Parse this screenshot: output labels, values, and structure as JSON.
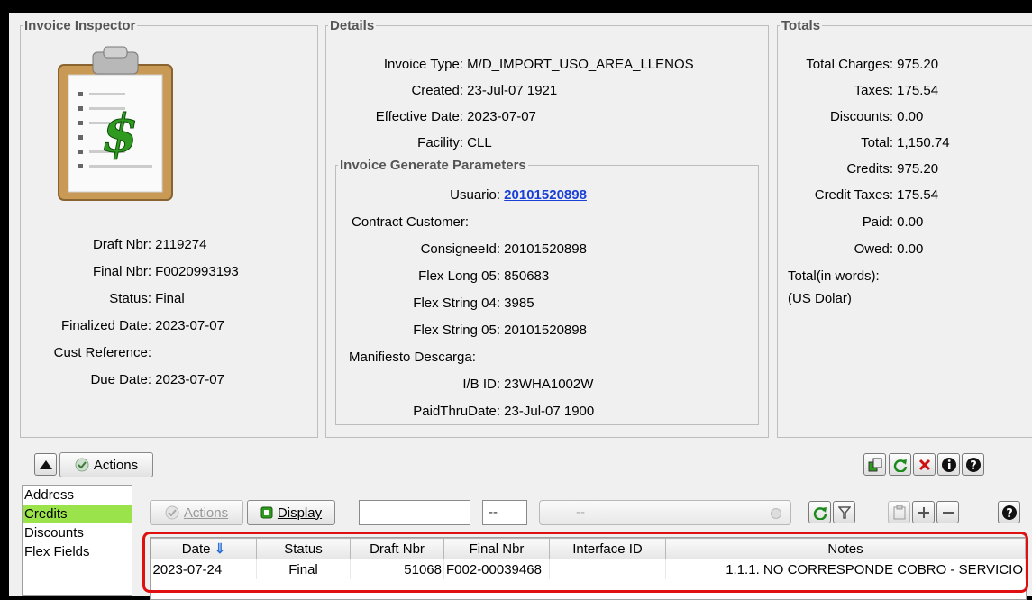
{
  "inspector": {
    "title": "Invoice Inspector",
    "fields": [
      {
        "label": "Draft Nbr:",
        "value": "2119274"
      },
      {
        "label": "Final Nbr:",
        "value": "F0020993193"
      },
      {
        "label": "Status:",
        "value": "Final"
      },
      {
        "label": "Finalized Date:",
        "value": "2023-07-07"
      },
      {
        "label": "Cust Reference:",
        "value": ""
      },
      {
        "label": "Due Date:",
        "value": "2023-07-07"
      }
    ]
  },
  "details": {
    "title": "Details",
    "fields": [
      {
        "label": "Invoice Type:",
        "value": "M/D_IMPORT_USO_AREA_LLENOS"
      },
      {
        "label": "Created:",
        "value": "23-Jul-07 1921"
      },
      {
        "label": "Effective Date:",
        "value": "2023-07-07"
      },
      {
        "label": "Facility:",
        "value": "CLL"
      }
    ],
    "params": {
      "title": "Invoice Generate Parameters",
      "usuario_label": "Usuario:",
      "usuario_value": "20101520898",
      "contract_customer": "Contract Customer:",
      "consignee_label": "ConsigneeId:",
      "consignee_value": "20101520898",
      "flex_long05_label": "Flex Long 05:",
      "flex_long05_value": "850683",
      "flex_string04_label": "Flex String 04:",
      "flex_string04_value": "3985",
      "flex_string05_label": "Flex String 05:",
      "flex_string05_value": "20101520898",
      "manifiesto": "Manifiesto Descarga:",
      "ib_label": "I/B ID:",
      "ib_value": "23WHA1002W",
      "paidthru_label": "PaidThruDate:",
      "paidthru_value": "23-Jul-07 1900"
    }
  },
  "totals": {
    "title": "Totals",
    "fields": [
      {
        "label": "Total Charges:",
        "value": "975.20"
      },
      {
        "label": "Taxes:",
        "value": "175.54"
      },
      {
        "label": "Discounts:",
        "value": "0.00"
      },
      {
        "label": "Total:",
        "value": "1,150.74"
      },
      {
        "label": "Credits:",
        "value": "975.20"
      },
      {
        "label": "Credit Taxes:",
        "value": "175.54"
      },
      {
        "label": "Paid:",
        "value": "0.00"
      },
      {
        "label": "Owed:",
        "value": "0.00"
      }
    ],
    "words_label": "Total(in words):",
    "words_value": "(US Dolar)"
  },
  "toolbar": {
    "actions_label": "Actions"
  },
  "sidebar": {
    "items": [
      "Address",
      "Credits",
      "Discounts",
      "Flex Fields"
    ],
    "selected": 1
  },
  "lower": {
    "actions_label": "Actions",
    "display_label": "Display",
    "filter_value": "",
    "combo1": "--",
    "combo2": "--"
  },
  "table": {
    "columns": [
      "Date",
      "Status",
      "Draft Nbr",
      "Final Nbr",
      "Interface ID",
      "Notes"
    ],
    "rows": [
      {
        "date": "2023-07-24",
        "status": "Final",
        "draft": "51068",
        "final": "F002-00039468",
        "interface": "",
        "notes": "1.1.1. NO CORRESPONDE COBRO - SERVICIO"
      }
    ]
  },
  "colors": {
    "highlight": "#e01010",
    "selected": "#9be34a",
    "link": "#1a3fd6"
  }
}
